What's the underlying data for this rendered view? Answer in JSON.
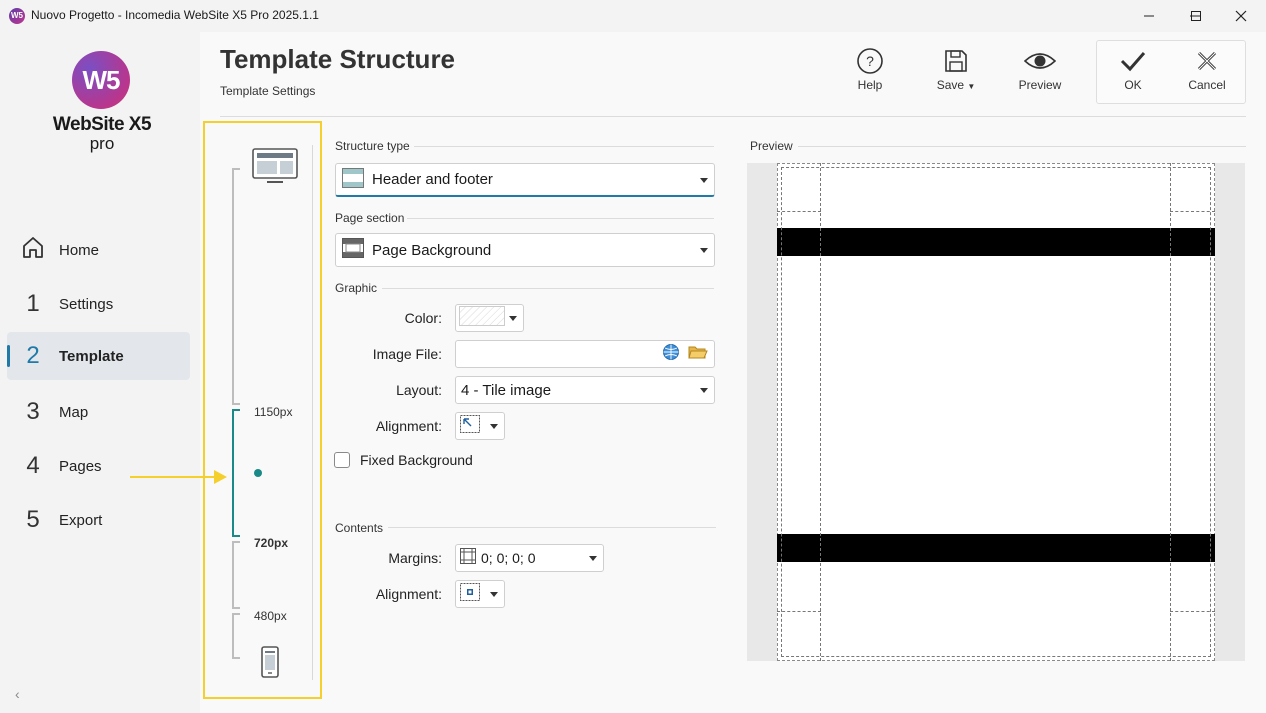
{
  "window": {
    "title": "Nuovo Progetto - Incomedia WebSite X5 Pro 2025.1.1",
    "app_icon": "W5"
  },
  "logo": {
    "mark": "W5",
    "name": "WebSite X5",
    "edition": "pro"
  },
  "nav": {
    "home": {
      "label": "Home"
    },
    "items": [
      {
        "num": "1",
        "label": "Settings"
      },
      {
        "num": "2",
        "label": "Template"
      },
      {
        "num": "3",
        "label": "Map"
      },
      {
        "num": "4",
        "label": "Pages"
      },
      {
        "num": "5",
        "label": "Export"
      }
    ],
    "active_index": 1,
    "collapse_glyph": "‹"
  },
  "header": {
    "title": "Template Structure",
    "subtitle": "Template Settings"
  },
  "toolbar": {
    "help": "Help",
    "save": "Save",
    "preview": "Preview",
    "ok": "OK",
    "cancel": "Cancel"
  },
  "resolutions": {
    "bp1": "1150px",
    "bp2": "720px",
    "bp3": "480px",
    "selected": "720px"
  },
  "form": {
    "structure_type_label": "Structure type",
    "structure_type_value": "Header and footer",
    "page_section_label": "Page section",
    "page_section_value": "Page Background",
    "graphic_label": "Graphic",
    "color_label": "Color:",
    "image_file_label": "Image File:",
    "image_file_value": "",
    "layout_label": "Layout:",
    "layout_value": "4 - Tile image",
    "alignment_label": "Alignment:",
    "fixed_bg_label": "Fixed Background",
    "fixed_bg_checked": false,
    "contents_label": "Contents",
    "margins_label": "Margins:",
    "margins_value": "0; 0; 0; 0",
    "contents_alignment_label": "Alignment:"
  },
  "preview": {
    "label": "Preview"
  },
  "colors": {
    "accent": "#1f7aa8",
    "teal": "#1a8a88",
    "highlight": "#f5cf2b"
  }
}
